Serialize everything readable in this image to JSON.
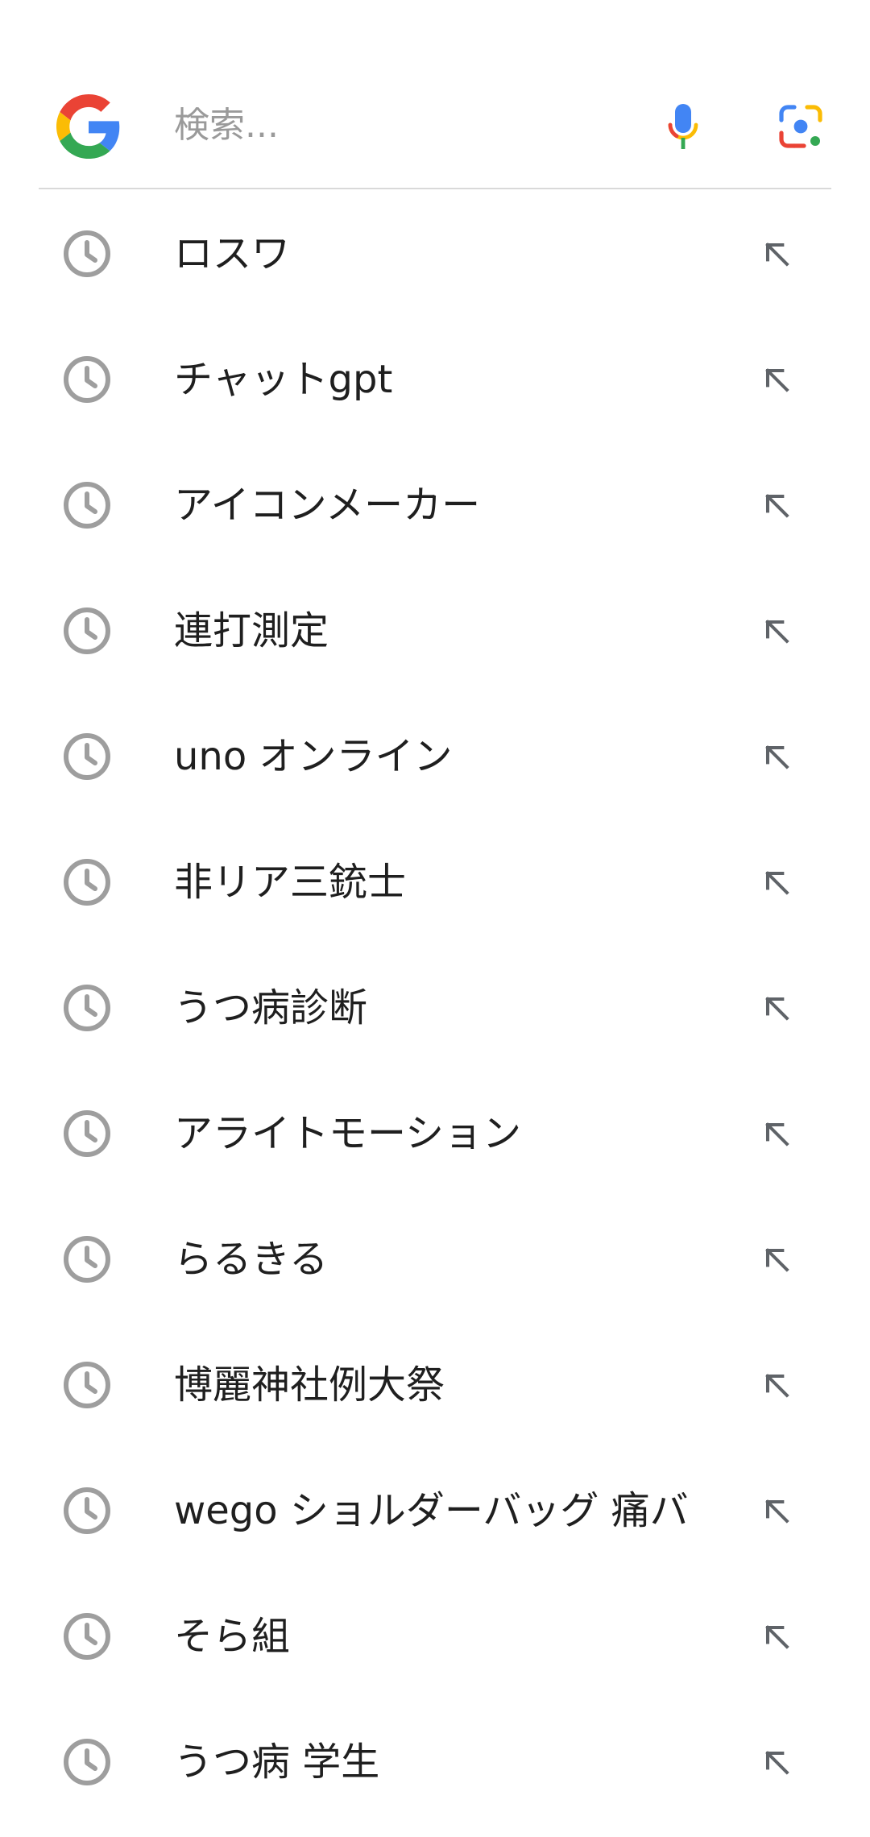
{
  "search": {
    "value": "",
    "placeholder": "検索..."
  },
  "icons": {
    "logo": "google-g-icon",
    "mic": "mic-icon",
    "lens": "google-lens-icon",
    "history": "clock-icon",
    "fill": "arrow-up-left-icon"
  },
  "colors": {
    "google_blue": "#4285F4",
    "google_red": "#EA4335",
    "google_yellow": "#FBBC05",
    "google_green": "#34A853",
    "icon_grey": "#9e9e9e",
    "divider": "#d9d9d9"
  },
  "history": [
    {
      "label": "ロスワ"
    },
    {
      "label": "チャットgpt"
    },
    {
      "label": "アイコンメーカー"
    },
    {
      "label": "連打測定"
    },
    {
      "label": "uno オンライン"
    },
    {
      "label": "非リア三銃士"
    },
    {
      "label": "うつ病診断"
    },
    {
      "label": "アライトモーション"
    },
    {
      "label": "らるきる"
    },
    {
      "label": "博麗神社例大祭"
    },
    {
      "label": "wego ショルダーバッグ 痛バ"
    },
    {
      "label": "そら組"
    },
    {
      "label": "うつ病 学生"
    }
  ]
}
